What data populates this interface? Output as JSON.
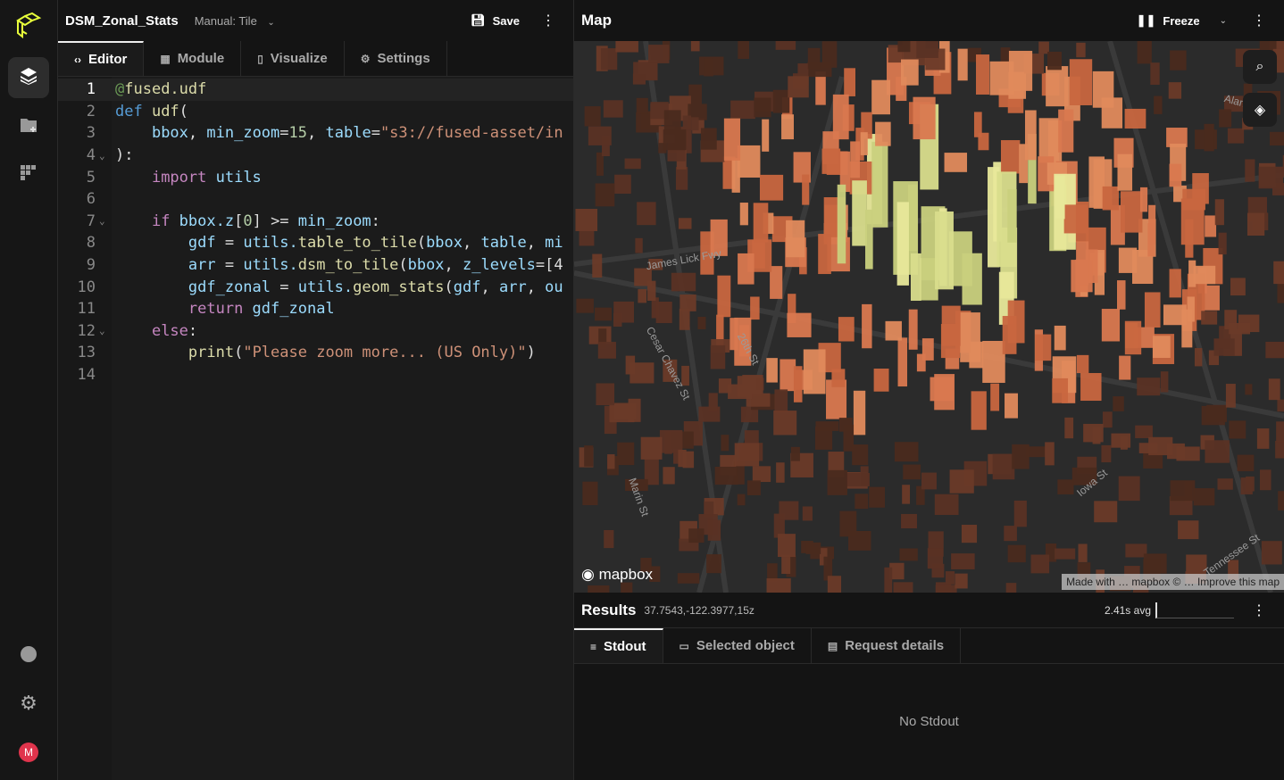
{
  "rail": {
    "items": [
      "layers",
      "add-folder",
      "module-grid"
    ],
    "bottom": [
      "help",
      "settings",
      "user"
    ],
    "avatar": "M",
    "accent": "#e8ff3b"
  },
  "editor": {
    "title": "DSM_Zonal_Stats",
    "mode": "Manual: Tile",
    "save": "Save",
    "tabs": [
      {
        "label": "Editor",
        "icon": "code-icon"
      },
      {
        "label": "Module",
        "icon": "grid-icon"
      },
      {
        "label": "Visualize",
        "icon": "map-icon"
      },
      {
        "label": "Settings",
        "icon": "gear-icon"
      }
    ],
    "lines": [
      [
        [
          "dc",
          "@"
        ],
        [
          "fn",
          "fused.udf"
        ]
      ],
      [
        [
          "df",
          "def "
        ],
        [
          "fn",
          "udf"
        ],
        [
          "pl",
          "("
        ]
      ],
      [
        [
          "pl",
          "    "
        ],
        [
          "vr",
          "bbox"
        ],
        [
          "pl",
          ", "
        ],
        [
          "vr",
          "min_zoom"
        ],
        [
          "pl",
          "="
        ],
        [
          "nm",
          "15"
        ],
        [
          "pl",
          ", "
        ],
        [
          "vr",
          "table"
        ],
        [
          "pl",
          "="
        ],
        [
          "st",
          "\"s3://fused-asset/in"
        ]
      ],
      [
        [
          "pl",
          "):"
        ]
      ],
      [
        [
          "pl",
          "    "
        ],
        [
          "kw",
          "import "
        ],
        [
          "vr",
          "utils"
        ]
      ],
      [],
      [
        [
          "pl",
          "    "
        ],
        [
          "kw",
          "if "
        ],
        [
          "vr",
          "bbox.z"
        ],
        [
          "pl",
          "["
        ],
        [
          "nm",
          "0"
        ],
        [
          "pl",
          "] >= "
        ],
        [
          "vr",
          "min_zoom"
        ],
        [
          "pl",
          ":"
        ]
      ],
      [
        [
          "pl",
          "        "
        ],
        [
          "vr",
          "gdf"
        ],
        [
          "pl",
          " = "
        ],
        [
          "vr",
          "utils."
        ],
        [
          "fn",
          "table_to_tile"
        ],
        [
          "pl",
          "("
        ],
        [
          "vr",
          "bbox"
        ],
        [
          "pl",
          ", "
        ],
        [
          "vr",
          "table"
        ],
        [
          "pl",
          ", "
        ],
        [
          "vr",
          "mi"
        ]
      ],
      [
        [
          "pl",
          "        "
        ],
        [
          "vr",
          "arr"
        ],
        [
          "pl",
          " = "
        ],
        [
          "vr",
          "utils."
        ],
        [
          "fn",
          "dsm_to_tile"
        ],
        [
          "pl",
          "("
        ],
        [
          "vr",
          "bbox"
        ],
        [
          "pl",
          ", "
        ],
        [
          "vr",
          "z_levels"
        ],
        [
          "pl",
          "=[4"
        ]
      ],
      [
        [
          "pl",
          "        "
        ],
        [
          "vr",
          "gdf_zonal"
        ],
        [
          "pl",
          " = "
        ],
        [
          "vr",
          "utils."
        ],
        [
          "fn",
          "geom_stats"
        ],
        [
          "pl",
          "("
        ],
        [
          "vr",
          "gdf"
        ],
        [
          "pl",
          ", "
        ],
        [
          "vr",
          "arr"
        ],
        [
          "pl",
          ", "
        ],
        [
          "vr",
          "ou"
        ]
      ],
      [
        [
          "pl",
          "        "
        ],
        [
          "kw",
          "return "
        ],
        [
          "vr",
          "gdf_zonal"
        ]
      ],
      [
        [
          "pl",
          "    "
        ],
        [
          "kw",
          "else"
        ],
        [
          "pl",
          ":"
        ]
      ],
      [
        [
          "pl",
          "        "
        ],
        [
          "fn",
          "print"
        ],
        [
          "pl",
          "("
        ],
        [
          "st",
          "\"Please zoom more... (US Only)\""
        ],
        [
          "pl",
          ")"
        ]
      ],
      []
    ],
    "foldable": [
      4,
      7,
      12
    ]
  },
  "map": {
    "title": "Map",
    "freeze": "Freeze",
    "streets": [
      "James Lick Fwy",
      "Cesar Chavez St",
      "26th St",
      "Marin St",
      "Iowa St",
      "Tennessee St",
      "Alan"
    ],
    "logo": "mapbox",
    "attribution": "Made with … mapbox © … Improve this map"
  },
  "results": {
    "title": "Results",
    "coords": "37.7543,-122.3977,15z",
    "avg": "2.41s avg",
    "tabs": [
      {
        "label": "Stdout",
        "icon": "list-icon"
      },
      {
        "label": "Selected object",
        "icon": "square-icon"
      },
      {
        "label": "Request details",
        "icon": "details-icon"
      }
    ],
    "empty": "No Stdout"
  }
}
